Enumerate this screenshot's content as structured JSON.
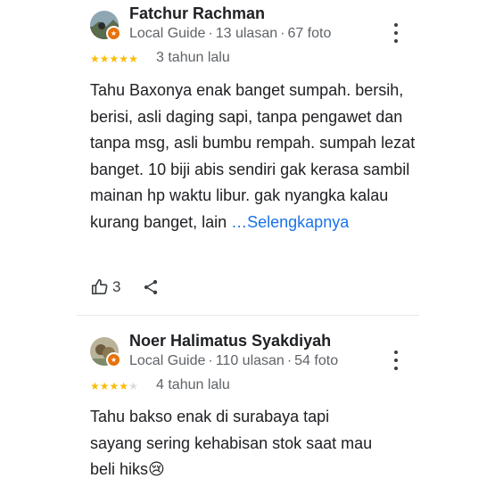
{
  "reviews": [
    {
      "name": "Fatchur Rachman",
      "role": "Local Guide",
      "reviews_count": "13 ulasan",
      "photos_count": "67 foto",
      "rating": 5,
      "when": "3 tahun lalu",
      "text": "Tahu Baxonya enak banget sumpah. bersih, berisi, asli daging sapi, tanpa pengawet dan tanpa msg, asli bumbu rempah. sumpah lezat banget. 10 biji abis sendiri gak kerasa sambil mainan hp waktu libur. gak nyangka kalau kurang banget, lain ",
      "more_label": "…Selengkapnya",
      "likes": "3"
    },
    {
      "name": "Noer Halimatus Syakdiyah",
      "role": "Local Guide",
      "reviews_count": "110 ulasan",
      "photos_count": "54 foto",
      "rating": 4,
      "when": "4 tahun lalu",
      "text": "Tahu bakso enak di surabaya tapi sayang sering kehabisan stok saat mau beli hiks😢"
    }
  ],
  "separator": "·",
  "colors": {
    "star": "#fbbc04",
    "star_empty": "#dadce0",
    "link": "#1a73e8",
    "badge": "#e8710a"
  },
  "icons": {
    "like": "thumb-up-icon",
    "share": "share-icon",
    "more": "more-vert-icon",
    "badge": "local-guide-star-icon"
  }
}
